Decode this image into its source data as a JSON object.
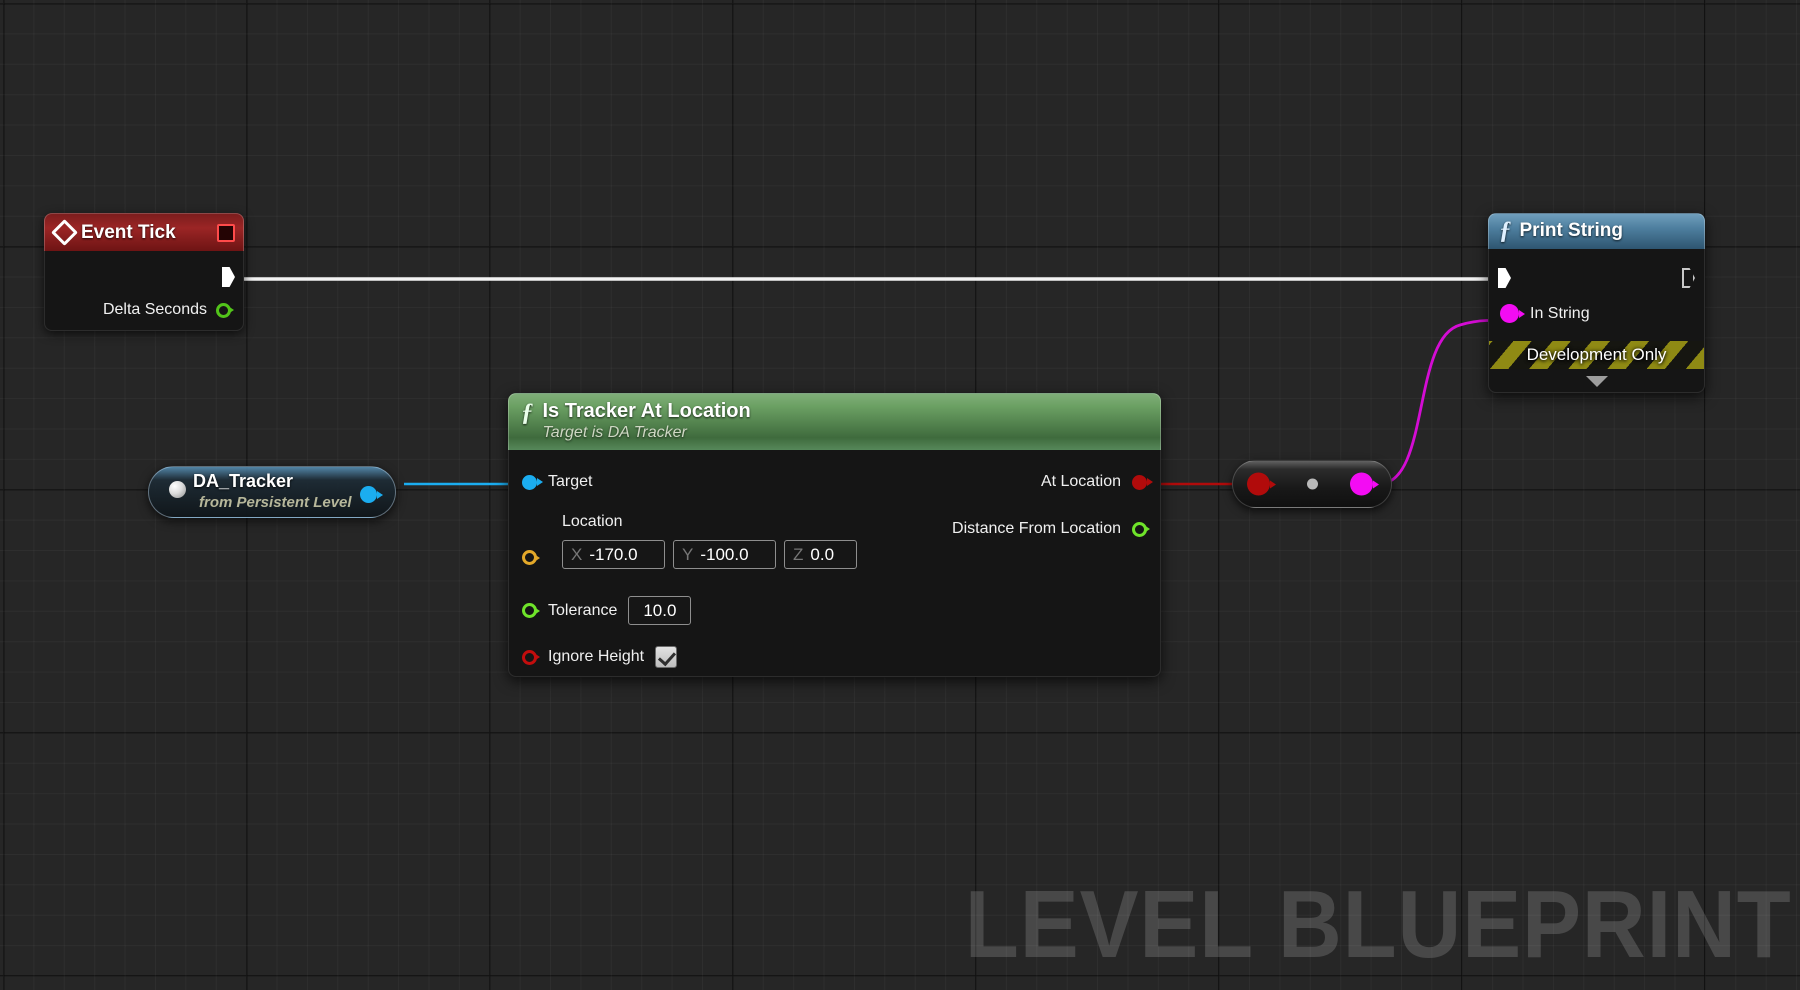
{
  "canvas": {
    "watermark": "LEVEL BLUEPRINT",
    "background_color": "#262626",
    "grid_minor_color": "#2e2e2e",
    "grid_major_color": "#1a1a1a"
  },
  "nodes": {
    "event_tick": {
      "title": "Event Tick",
      "icon": "event-diamond-icon",
      "stop_icon": "stop-square-icon",
      "exec_out_pin": "exec-out",
      "outputs": [
        {
          "label": "Delta Seconds",
          "pin_type": "float",
          "pin_color": "#52c41a",
          "pin_style": "hollow"
        }
      ]
    },
    "da_tracker": {
      "title": "DA_Tracker",
      "subtitle": "from Persistent Level",
      "pin_color": "#1badf0",
      "pin_style": "filled"
    },
    "is_tracker_at_location": {
      "title": "Is Tracker At Location",
      "subtitle": "Target is DA Tracker",
      "icon": "function-f-icon",
      "inputs": [
        {
          "label": "Target",
          "pin_color": "#1badf0",
          "pin_style": "filled"
        },
        {
          "label": "Location",
          "pin_color": "#e3a829",
          "pin_style": "hollow"
        },
        {
          "label": "Tolerance",
          "pin_color": "#6fe32a",
          "pin_style": "hollow",
          "value": "10.0"
        },
        {
          "label": "Ignore Height",
          "pin_color": "#c20d0d",
          "pin_style": "hollow",
          "checked": true
        }
      ],
      "location_value": {
        "x_axis": "X",
        "x": "-170.0",
        "y_axis": "Y",
        "y": "-100.0",
        "z_axis": "Z",
        "z": "0.0"
      },
      "outputs": [
        {
          "label": "At Location",
          "pin_color": "#b10b0b",
          "pin_style": "filled"
        },
        {
          "label": "Distance From Location",
          "pin_color": "#6fe32a",
          "pin_style": "hollow"
        }
      ]
    },
    "knot_convert": {
      "input_pin_color": "#b10b0b",
      "center_dot_color": "#b9b9b9",
      "output_pin_color": "#f30cf3"
    },
    "print_string": {
      "title": "Print String",
      "icon": "function-f-icon",
      "exec_in_pin": "exec-in",
      "exec_out_pin": "exec-out",
      "inputs": [
        {
          "label": "In String",
          "pin_color": "#f30cf3",
          "pin_style": "filled"
        }
      ],
      "dev_banner": "Development Only",
      "expand_arrow": "chevron-down-icon"
    }
  },
  "wires": [
    {
      "name": "exec-tick-to-print",
      "color": "#f2f2f2"
    },
    {
      "name": "tracker-to-target",
      "color": "#1badf0"
    },
    {
      "name": "atlocation-to-knot",
      "color": "#b10b0b"
    },
    {
      "name": "knot-to-instring",
      "color": "#d40cd4"
    }
  ]
}
